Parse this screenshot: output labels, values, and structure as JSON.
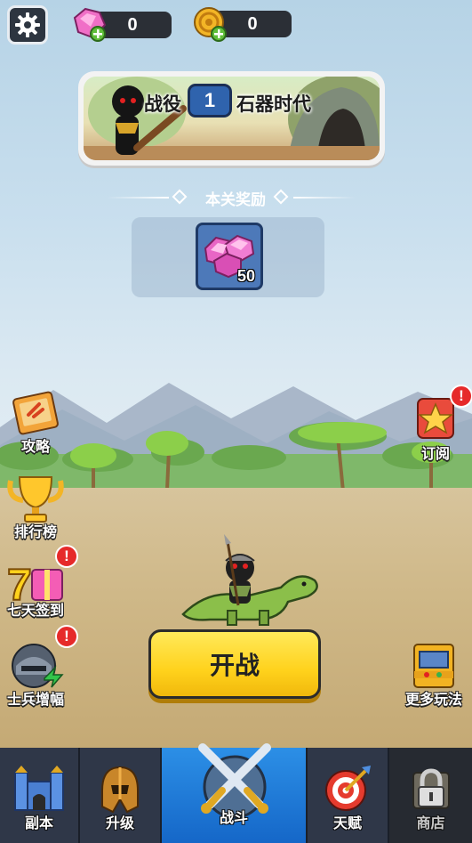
{
  "top_bar": {
    "gems": "0",
    "coins": "0"
  },
  "battle": {
    "prefix": "战役",
    "level": "1",
    "era": "石器时代"
  },
  "reward": {
    "title": "本关奖励",
    "item_count": "50"
  },
  "left_menu": [
    {
      "label": "攻略"
    },
    {
      "label": "排行榜"
    },
    {
      "label": "七天签到"
    },
    {
      "label": "士兵增幅"
    }
  ],
  "right_menu": [
    {
      "label": "订阅"
    },
    {
      "label": "更多玩法"
    }
  ],
  "alert_mark": "!",
  "fight_button": "开战",
  "bottom_nav": [
    {
      "label": "副本"
    },
    {
      "label": "升级"
    },
    {
      "label": "战斗"
    },
    {
      "label": "天赋"
    },
    {
      "label": "商店"
    }
  ],
  "colors": {
    "accent_yellow": "#ffd21c",
    "nav_active": "#1a78d8",
    "alert_red": "#e62a2a"
  }
}
